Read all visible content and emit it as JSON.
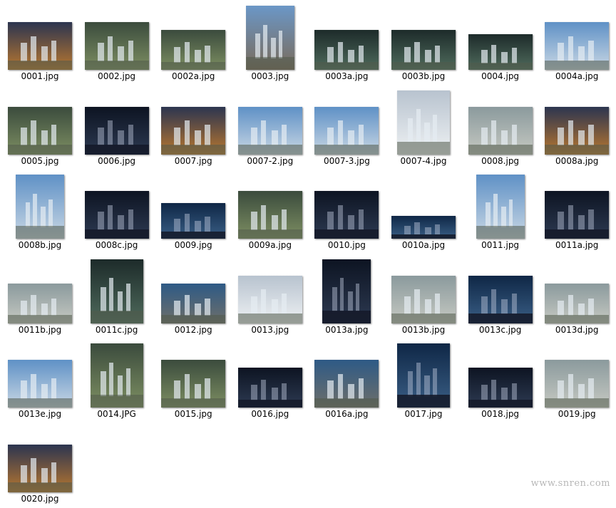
{
  "files": [
    {
      "name": "0001.jpg",
      "shape": "landscape",
      "tone": "dusk"
    },
    {
      "name": "0002.jpg",
      "shape": "landscape",
      "tone": "aerial-green"
    },
    {
      "name": "0002a.jpg",
      "shape": "wide",
      "tone": "aerial-green"
    },
    {
      "name": "0003.jpg",
      "shape": "portrait",
      "tone": "street"
    },
    {
      "name": "0003a.jpg",
      "shape": "wide",
      "tone": "aerial-dark"
    },
    {
      "name": "0003b.jpg",
      "shape": "wide",
      "tone": "aerial-dark"
    },
    {
      "name": "0004.jpg",
      "shape": "wide-small",
      "tone": "aerial-dark"
    },
    {
      "name": "0004a.jpg",
      "shape": "landscape",
      "tone": "towers-day"
    },
    {
      "name": "0005.jpg",
      "shape": "landscape",
      "tone": "aerial-green"
    },
    {
      "name": "0006.jpg",
      "shape": "landscape",
      "tone": "night"
    },
    {
      "name": "0007.jpg",
      "shape": "landscape",
      "tone": "dusk"
    },
    {
      "name": "0007-2.jpg",
      "shape": "landscape",
      "tone": "towers-day"
    },
    {
      "name": "0007-3.jpg",
      "shape": "landscape",
      "tone": "towers-day"
    },
    {
      "name": "0007-4.jpg",
      "shape": "portrait-square",
      "tone": "towers-white"
    },
    {
      "name": "0008.jpg",
      "shape": "landscape",
      "tone": "aerial-light"
    },
    {
      "name": "0008a.jpg",
      "shape": "landscape",
      "tone": "dusk"
    },
    {
      "name": "0008b.jpg",
      "shape": "portrait",
      "tone": "towers-day"
    },
    {
      "name": "0008c.jpg",
      "shape": "landscape",
      "tone": "night"
    },
    {
      "name": "0009.jpg",
      "shape": "wide-small",
      "tone": "night-blue"
    },
    {
      "name": "0009a.jpg",
      "shape": "landscape",
      "tone": "aerial-green"
    },
    {
      "name": "0010.jpg",
      "shape": "landscape",
      "tone": "night"
    },
    {
      "name": "0010a.jpg",
      "shape": "wide-thin",
      "tone": "night-blue"
    },
    {
      "name": "0011.jpg",
      "shape": "portrait",
      "tone": "towers-day"
    },
    {
      "name": "0011a.jpg",
      "shape": "landscape",
      "tone": "night"
    },
    {
      "name": "0011b.jpg",
      "shape": "wide",
      "tone": "aerial-light"
    },
    {
      "name": "0011c.jpg",
      "shape": "portrait-square",
      "tone": "aerial-dark"
    },
    {
      "name": "0012.jpg",
      "shape": "wide",
      "tone": "dusk-blue"
    },
    {
      "name": "0013.jpg",
      "shape": "landscape",
      "tone": "towers-white"
    },
    {
      "name": "0013a.jpg",
      "shape": "portrait",
      "tone": "night"
    },
    {
      "name": "0013b.jpg",
      "shape": "landscape",
      "tone": "aerial-light"
    },
    {
      "name": "0013c.jpg",
      "shape": "landscape",
      "tone": "night-blue"
    },
    {
      "name": "0013d.jpg",
      "shape": "wide",
      "tone": "aerial-light"
    },
    {
      "name": "0013e.jpg",
      "shape": "landscape",
      "tone": "towers-day"
    },
    {
      "name": "0014.JPG",
      "shape": "portrait-square",
      "tone": "aerial-green"
    },
    {
      "name": "0015.jpg",
      "shape": "landscape",
      "tone": "aerial-green"
    },
    {
      "name": "0016.jpg",
      "shape": "wide",
      "tone": "night"
    },
    {
      "name": "0016a.jpg",
      "shape": "landscape",
      "tone": "dusk-blue"
    },
    {
      "name": "0017.jpg",
      "shape": "portrait-square",
      "tone": "night-blue"
    },
    {
      "name": "0018.jpg",
      "shape": "wide",
      "tone": "night"
    },
    {
      "name": "0019.jpg",
      "shape": "landscape",
      "tone": "aerial-light"
    },
    {
      "name": "0020.jpg",
      "shape": "landscape",
      "tone": "dusk"
    }
  ],
  "watermark": "www.snren.com",
  "tones": {
    "dusk": [
      "#2c3550",
      "#b9772f"
    ],
    "dusk-blue": [
      "#2e5a86",
      "#6e6f6a"
    ],
    "aerial-green": [
      "#3b4b3d",
      "#7d8f62"
    ],
    "aerial-dark": [
      "#1d2b2a",
      "#4f6b5c"
    ],
    "aerial-light": [
      "#8b9a9d",
      "#c6c9c2"
    ],
    "towers-day": [
      "#5f91c6",
      "#c9d7e4"
    ],
    "towers-white": [
      "#b8c3cf",
      "#eef1f3"
    ],
    "night": [
      "#0d1422",
      "#2d3a52"
    ],
    "night-blue": [
      "#0f2746",
      "#3a5f86"
    ],
    "street": [
      "#6b97c7",
      "#7a6b5a"
    ]
  }
}
